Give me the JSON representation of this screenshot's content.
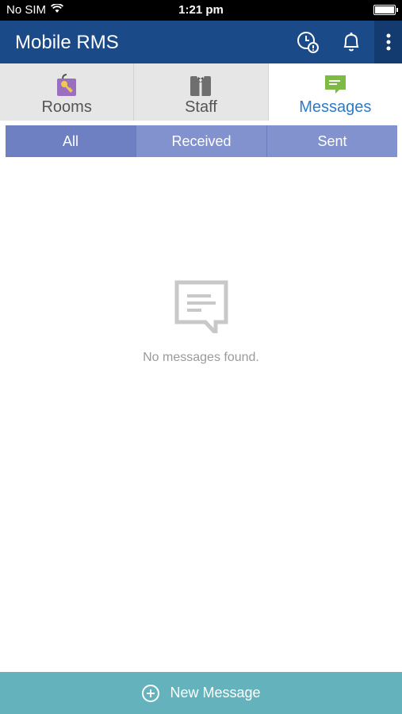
{
  "status": {
    "carrier": "No SIM",
    "time": "1:21 pm"
  },
  "app_bar": {
    "title": "Mobile RMS",
    "icons": [
      "clock-alert-icon",
      "bell-icon",
      "more-vertical-icon"
    ]
  },
  "tabs": [
    {
      "label": "Rooms",
      "icon": "rooms-key-icon",
      "active": false
    },
    {
      "label": "Staff",
      "icon": "staff-uniform-icon",
      "active": false
    },
    {
      "label": "Messages",
      "icon": "message-icon",
      "active": true
    }
  ],
  "filters": [
    {
      "label": "All",
      "active": true
    },
    {
      "label": "Received",
      "active": false
    },
    {
      "label": "Sent",
      "active": false
    }
  ],
  "empty_state": {
    "icon": "message-outline-icon",
    "text": "No messages found."
  },
  "bottom_action": {
    "label": "New Message",
    "icon": "plus-circle-icon"
  },
  "colors": {
    "app_bar": "#1b4a88",
    "active_tab_text": "#2e7bc6",
    "filter_bar": "#8292cf",
    "filter_active": "#6f80c2",
    "bottom_bar": "#64b3bc",
    "rooms_icon": "#9a6fbf",
    "messages_icon": "#7dbb45"
  }
}
